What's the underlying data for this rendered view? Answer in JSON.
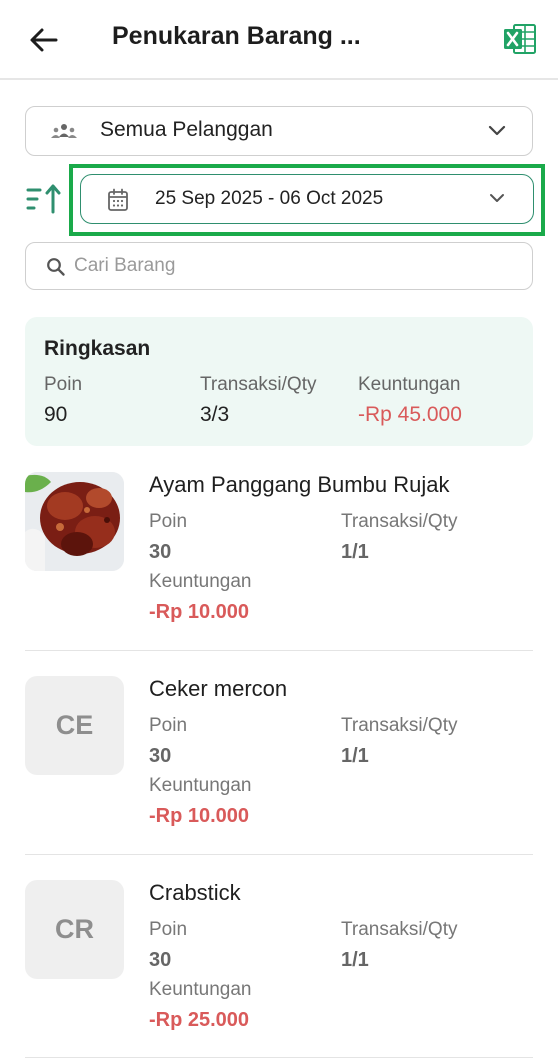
{
  "header": {
    "title": "Penukaran Barang ...",
    "back_icon": "arrow-left-icon",
    "export_icon": "excel-icon"
  },
  "filters": {
    "customer": {
      "label": "Semua Pelanggan",
      "icon": "people-icon"
    },
    "date_range": {
      "label": "25 Sep 2025 - 06 Oct 2025",
      "icon": "calendar-icon"
    },
    "sort_icon": "sort-icon",
    "search_placeholder": "Cari Barang"
  },
  "summary": {
    "title": "Ringkasan",
    "cols": [
      {
        "label": "Poin",
        "value": "90"
      },
      {
        "label": "Transaksi/Qty",
        "value": "3/3"
      },
      {
        "label": "Keuntungan",
        "value": "-Rp 45.000"
      }
    ]
  },
  "items": [
    {
      "name": "Ayam Panggang Bumbu Rujak",
      "thumb": "",
      "has_photo": true,
      "points_label": "Poin",
      "points": "30",
      "trx_label": "Transaksi/Qty",
      "trx": "1/1",
      "profit_label": "Keuntungan",
      "profit": "-Rp 10.000"
    },
    {
      "name": "Ceker mercon",
      "thumb": "CE",
      "has_photo": false,
      "points_label": "Poin",
      "points": "30",
      "trx_label": "Transaksi/Qty",
      "trx": "1/1",
      "profit_label": "Keuntungan",
      "profit": "-Rp 10.000"
    },
    {
      "name": "Crabstick",
      "thumb": "CR",
      "has_photo": false,
      "points_label": "Poin",
      "points": "30",
      "trx_label": "Transaksi/Qty",
      "trx": "1/1",
      "profit_label": "Keuntungan",
      "profit": "-Rp 25.000"
    }
  ],
  "colors": {
    "accent": "#2f8f6f",
    "highlight": "#1aaa4a",
    "negative": "#d95a5a",
    "summary_bg": "#eef8f4"
  }
}
